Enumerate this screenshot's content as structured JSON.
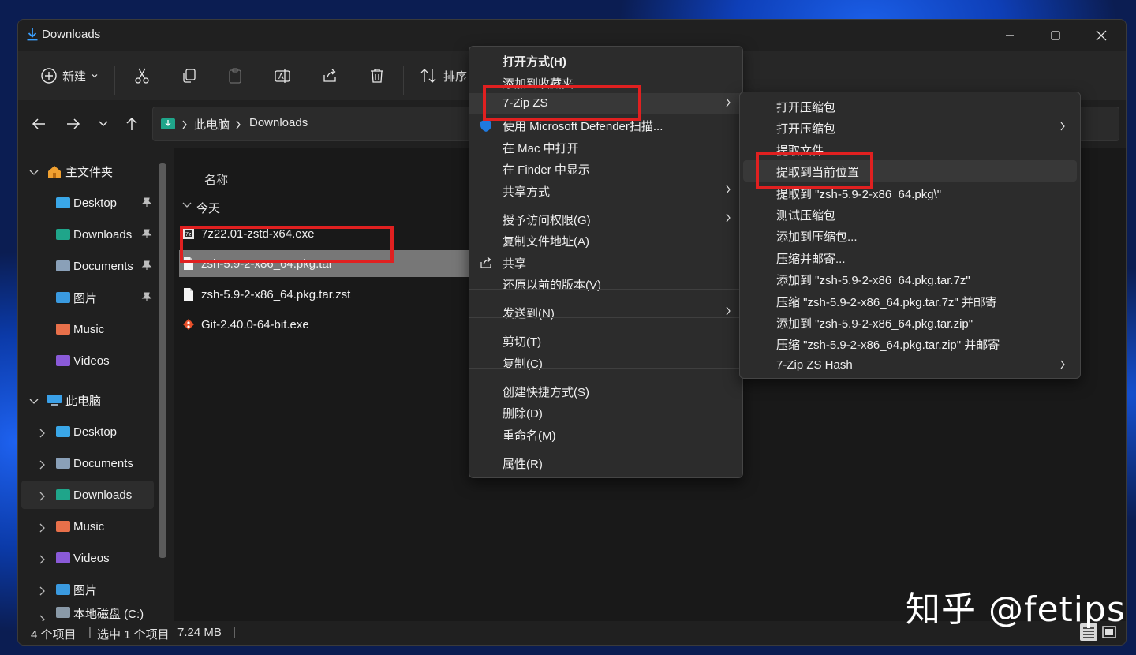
{
  "window": {
    "title": "Downloads"
  },
  "toolbar": {
    "new_label": "新建",
    "sort_label": "排序"
  },
  "address": {
    "root": "此电脑",
    "folder": "Downloads"
  },
  "sidebar": {
    "home": "主文件夹",
    "quick": [
      "Desktop",
      "Downloads",
      "Documents",
      "图片",
      "Music",
      "Videos"
    ],
    "thispc": "此电脑",
    "pc_items": [
      "Desktop",
      "Documents",
      "Downloads",
      "Music",
      "Videos",
      "图片",
      "本地磁盘 (C:)"
    ]
  },
  "content": {
    "col_name": "名称",
    "group": "今天",
    "files": [
      "7z22.01-zstd-x64.exe",
      "zsh-5.9-2-x86_64.pkg.tar",
      "zsh-5.9-2-x86_64.pkg.tar.zst",
      "Git-2.40.0-64-bit.exe"
    ]
  },
  "status": {
    "count": "4 个项目",
    "selected": "选中 1 个项目",
    "size": "7.24 MB"
  },
  "context_menu": {
    "items": [
      {
        "label": "打开方式(H)",
        "arrow": false
      },
      {
        "label": "添加到收藏夹",
        "arrow": false
      },
      {
        "label": "7-Zip ZS",
        "arrow": true
      },
      {
        "label": "使用 Microsoft Defender扫描...",
        "arrow": false
      },
      {
        "label": "在 Mac 中打开",
        "arrow": false
      },
      {
        "label": "在 Finder 中显示",
        "arrow": false
      },
      {
        "label": "共享方式",
        "arrow": true
      },
      {
        "label": "授予访问权限(G)",
        "arrow": true
      },
      {
        "label": "复制文件地址(A)",
        "arrow": false
      },
      {
        "label": "共享",
        "arrow": false
      },
      {
        "label": "还原以前的版本(V)",
        "arrow": false
      },
      {
        "label": "发送到(N)",
        "arrow": true
      },
      {
        "label": "剪切(T)",
        "arrow": false
      },
      {
        "label": "复制(C)",
        "arrow": false
      },
      {
        "label": "创建快捷方式(S)",
        "arrow": false
      },
      {
        "label": "删除(D)",
        "arrow": false
      },
      {
        "label": "重命名(M)",
        "arrow": false
      },
      {
        "label": "属性(R)",
        "arrow": false
      }
    ]
  },
  "submenu": {
    "items": [
      {
        "label": "打开压缩包",
        "arrow": false
      },
      {
        "label": "打开压缩包",
        "arrow": true
      },
      {
        "label": "提取文件...",
        "arrow": false
      },
      {
        "label": "提取到当前位置",
        "arrow": false
      },
      {
        "label": "提取到 \"zsh-5.9-2-x86_64.pkg\\\"",
        "arrow": false
      },
      {
        "label": "测试压缩包",
        "arrow": false
      },
      {
        "label": "添加到压缩包...",
        "arrow": false
      },
      {
        "label": "压缩并邮寄...",
        "arrow": false
      },
      {
        "label": "添加到 \"zsh-5.9-2-x86_64.pkg.tar.7z\"",
        "arrow": false
      },
      {
        "label": "压缩 \"zsh-5.9-2-x86_64.pkg.tar.7z\" 并邮寄",
        "arrow": false
      },
      {
        "label": "添加到 \"zsh-5.9-2-x86_64.pkg.tar.zip\"",
        "arrow": false
      },
      {
        "label": "压缩 \"zsh-5.9-2-x86_64.pkg.tar.zip\" 并邮寄",
        "arrow": false
      },
      {
        "label": "7-Zip ZS Hash",
        "arrow": true
      }
    ]
  },
  "watermark": "知乎 @fetips",
  "colors": {
    "highlight_red": "#e02020",
    "folder_blue": "#2d8fe0"
  }
}
